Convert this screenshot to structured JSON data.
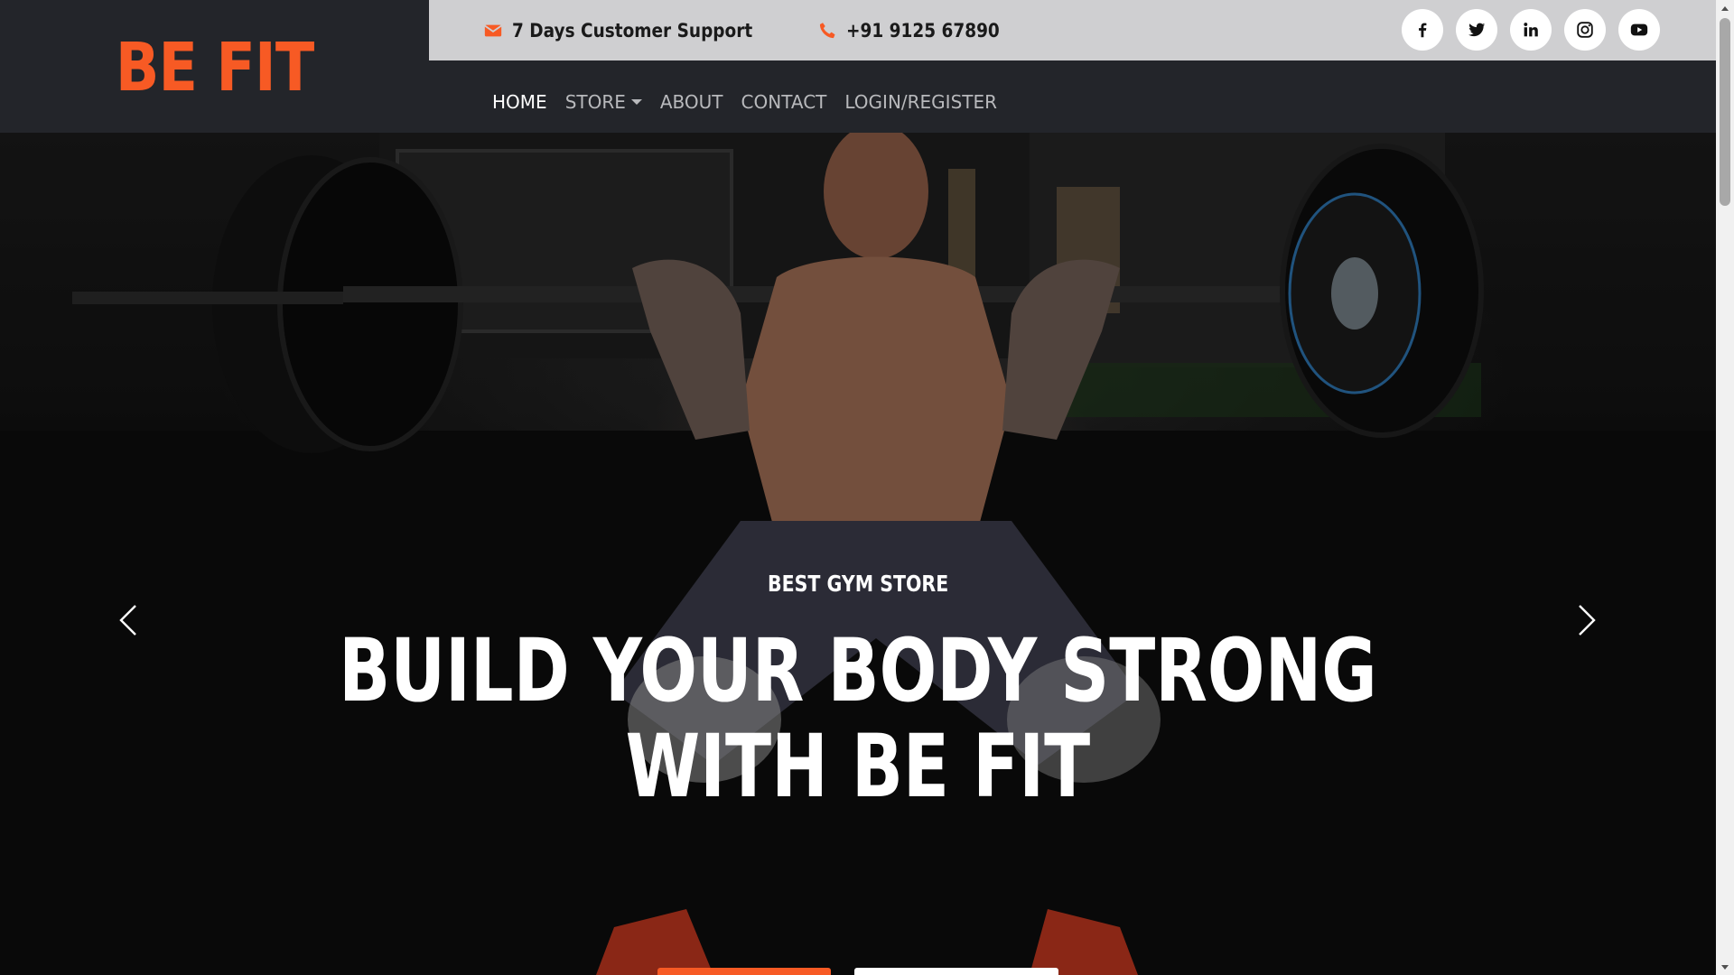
{
  "brand": {
    "logo_text": "BE FIT",
    "accent_color": "#f75a24"
  },
  "topbar": {
    "support": {
      "icon": "envelope-icon",
      "text": "7 Days Customer Support"
    },
    "phone": {
      "icon": "phone-icon",
      "text": "+91 9125 67890"
    },
    "socials": [
      {
        "name": "facebook",
        "icon": "facebook-icon"
      },
      {
        "name": "twitter",
        "icon": "twitter-icon"
      },
      {
        "name": "linkedin",
        "icon": "linkedin-icon"
      },
      {
        "name": "instagram",
        "icon": "instagram-icon"
      },
      {
        "name": "youtube",
        "icon": "youtube-icon"
      }
    ]
  },
  "nav": {
    "items": [
      {
        "label": "HOME",
        "active": true
      },
      {
        "label": "STORE",
        "dropdown": true
      },
      {
        "label": "ABOUT"
      },
      {
        "label": "CONTACT"
      },
      {
        "label": "LOGIN/REGISTER"
      }
    ]
  },
  "hero": {
    "subtitle": "BEST GYM STORE",
    "title_line1": "BUILD YOUR BODY STRONG",
    "title_line2": "WITH BE FIT",
    "prev_icon": "chevron-left-icon",
    "next_icon": "chevron-right-icon"
  }
}
